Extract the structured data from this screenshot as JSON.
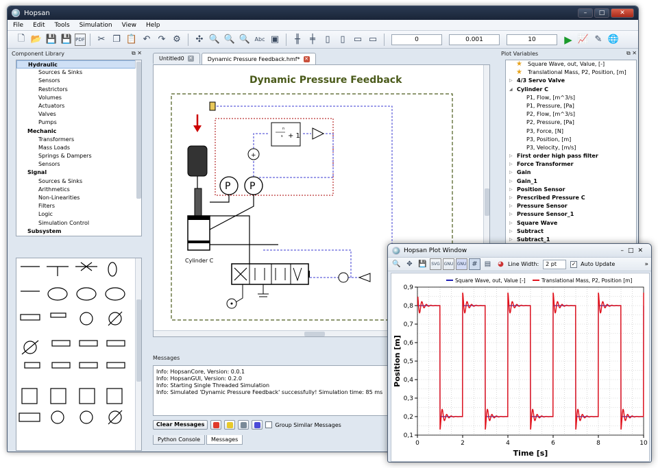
{
  "window": {
    "title": "Hopsan"
  },
  "menu": [
    "File",
    "Edit",
    "Tools",
    "Simulation",
    "View",
    "Help"
  ],
  "toolbar": {
    "start_time": "0",
    "time_step": "0.001",
    "stop_time": "10",
    "pdf_label": "PDF"
  },
  "library": {
    "title": "Component Library",
    "tree": [
      {
        "label": "Hydraulic",
        "kind": "cat",
        "selected": true
      },
      {
        "label": "Sources & Sinks",
        "kind": "sub"
      },
      {
        "label": "Sensors",
        "kind": "sub"
      },
      {
        "label": "Restrictors",
        "kind": "sub"
      },
      {
        "label": "Volumes",
        "kind": "sub"
      },
      {
        "label": "Actuators",
        "kind": "sub"
      },
      {
        "label": "Valves",
        "kind": "sub"
      },
      {
        "label": "Pumps",
        "kind": "sub"
      },
      {
        "label": "Mechanic",
        "kind": "cat"
      },
      {
        "label": "Transformers",
        "kind": "sub"
      },
      {
        "label": "Mass Loads",
        "kind": "sub"
      },
      {
        "label": "Springs & Dampers",
        "kind": "sub"
      },
      {
        "label": "Sensors",
        "kind": "sub"
      },
      {
        "label": "Signal",
        "kind": "cat"
      },
      {
        "label": "Sources & Sinks",
        "kind": "sub"
      },
      {
        "label": "Arithmetics",
        "kind": "sub"
      },
      {
        "label": "Non-Linearities",
        "kind": "sub"
      },
      {
        "label": "Filters",
        "kind": "sub"
      },
      {
        "label": "Logic",
        "kind": "sub"
      },
      {
        "label": "Simulation Control",
        "kind": "sub"
      },
      {
        "label": "Subsystem",
        "kind": "cat"
      }
    ]
  },
  "tabs": [
    {
      "label": "Untitled0",
      "active": false
    },
    {
      "label": "Dynamic Pressure Feedback.hmf*",
      "active": true
    }
  ],
  "model": {
    "title": "Dynamic Pressure Feedback",
    "cylinder_label": "Cylinder C",
    "tf_num_top": "n",
    "tf_den_top": "s",
    "tf_expr": "+ 1"
  },
  "messages": {
    "title": "Messages",
    "lines": [
      "Info: HopsanCore, Version: 0.0.1",
      "Info: HopsanGUI, Version: 0.2.0",
      "Info: Starting Single Threaded Simulation",
      "Info: Simulated 'Dynamic Pressure Feedback' successfully!  Simulation time: 85 ms"
    ],
    "clear_label": "Clear Messages",
    "group_label": "Group Similar Messages",
    "filter_colors": [
      "#e03a2a",
      "#e8c92a",
      "#7a8a98",
      "#4a4ad8"
    ]
  },
  "bottom_tabs": [
    {
      "label": "Python Console",
      "active": false
    },
    {
      "label": "Messages",
      "active": true
    }
  ],
  "plot_vars": {
    "title": "Plot Variables",
    "items": [
      {
        "label": "Square Wave, out, Value, [-]",
        "kind": "fav"
      },
      {
        "label": "Translational Mass, P2, Position, [m]",
        "kind": "fav"
      },
      {
        "label": "4/3 Servo Valve",
        "kind": "cat"
      },
      {
        "label": "Cylinder C",
        "kind": "cat",
        "open": true
      },
      {
        "label": "P1, Flow, [m^3/s]",
        "kind": "sub"
      },
      {
        "label": "P1, Pressure, [Pa]",
        "kind": "sub"
      },
      {
        "label": "P2, Flow, [m^3/s]",
        "kind": "sub"
      },
      {
        "label": "P2, Pressure, [Pa]",
        "kind": "sub"
      },
      {
        "label": "P3, Force, [N]",
        "kind": "sub"
      },
      {
        "label": "P3, Position, [m]",
        "kind": "sub"
      },
      {
        "label": "P3, Velocity, [m/s]",
        "kind": "sub"
      },
      {
        "label": "First order high pass filter",
        "kind": "cat"
      },
      {
        "label": "Force Transformer",
        "kind": "cat"
      },
      {
        "label": "Gain",
        "kind": "cat"
      },
      {
        "label": "Gain_1",
        "kind": "cat"
      },
      {
        "label": "Position Sensor",
        "kind": "cat"
      },
      {
        "label": "Prescribed Pressure C",
        "kind": "cat"
      },
      {
        "label": "Pressure Sensor",
        "kind": "cat"
      },
      {
        "label": "Pressure Sensor_1",
        "kind": "cat"
      },
      {
        "label": "Square Wave",
        "kind": "cat"
      },
      {
        "label": "Subtract",
        "kind": "cat"
      },
      {
        "label": "Subtract_1",
        "kind": "cat"
      }
    ]
  },
  "plot_window": {
    "title": "Hopsan Plot Window",
    "line_width_label": "Line Width:",
    "line_width_value": "2 pt",
    "auto_update_label": "Auto Update",
    "toolbar_labels": {
      "svg": "SVG",
      "gnu": "GNU"
    },
    "overflow": "»"
  },
  "chart_data": {
    "type": "line",
    "xlabel": "Time [s]",
    "ylabel": "Position [m]",
    "xlim": [
      0,
      10
    ],
    "ylim": [
      0.1,
      0.9
    ],
    "xticks": [
      0,
      2,
      4,
      6,
      8,
      10
    ],
    "yticks": [
      0.1,
      0.2,
      0.3,
      0.4,
      0.5,
      0.6,
      0.7,
      0.8,
      0.9
    ],
    "ytick_labels": [
      "0,1",
      "0,2",
      "0,3",
      "0,4",
      "0,5",
      "0,6",
      "0,7",
      "0,8",
      "0,9"
    ],
    "grid": true,
    "legend_position": "top",
    "series": [
      {
        "name": "Square Wave, out, Value [-]",
        "color": "#1f1fb4",
        "low": 0.2,
        "high": 0.8,
        "period": 2,
        "high_start": 0.0,
        "high_duration": 1.0
      },
      {
        "name": "Translational Mass, P2, Position [m]",
        "color": "#e0141e",
        "low": 0.2,
        "high": 0.8,
        "period": 2,
        "high_start": 0.0,
        "high_duration": 1.0,
        "overshoot": 0.07,
        "damping": 6,
        "ring_period": 0.2
      }
    ]
  }
}
